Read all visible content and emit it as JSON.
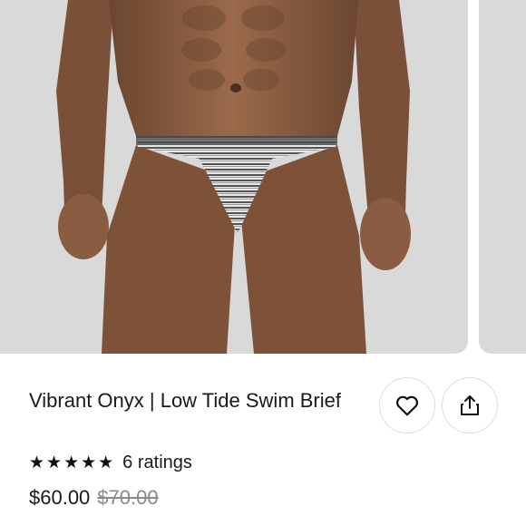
{
  "product": {
    "title": "Vibrant Onyx | Low Tide Swim Brief",
    "stars": "★★★★★",
    "rating_value": 5,
    "ratings_label": "6 ratings",
    "price": "$60.00",
    "original_price": "$70.00"
  },
  "actions": {
    "like_icon": "heart-icon",
    "share_icon": "share-icon"
  },
  "colors": {
    "photo_bg": "#d9d9d9",
    "text": "#1a1a1a",
    "strike": "#8a8a8a"
  }
}
